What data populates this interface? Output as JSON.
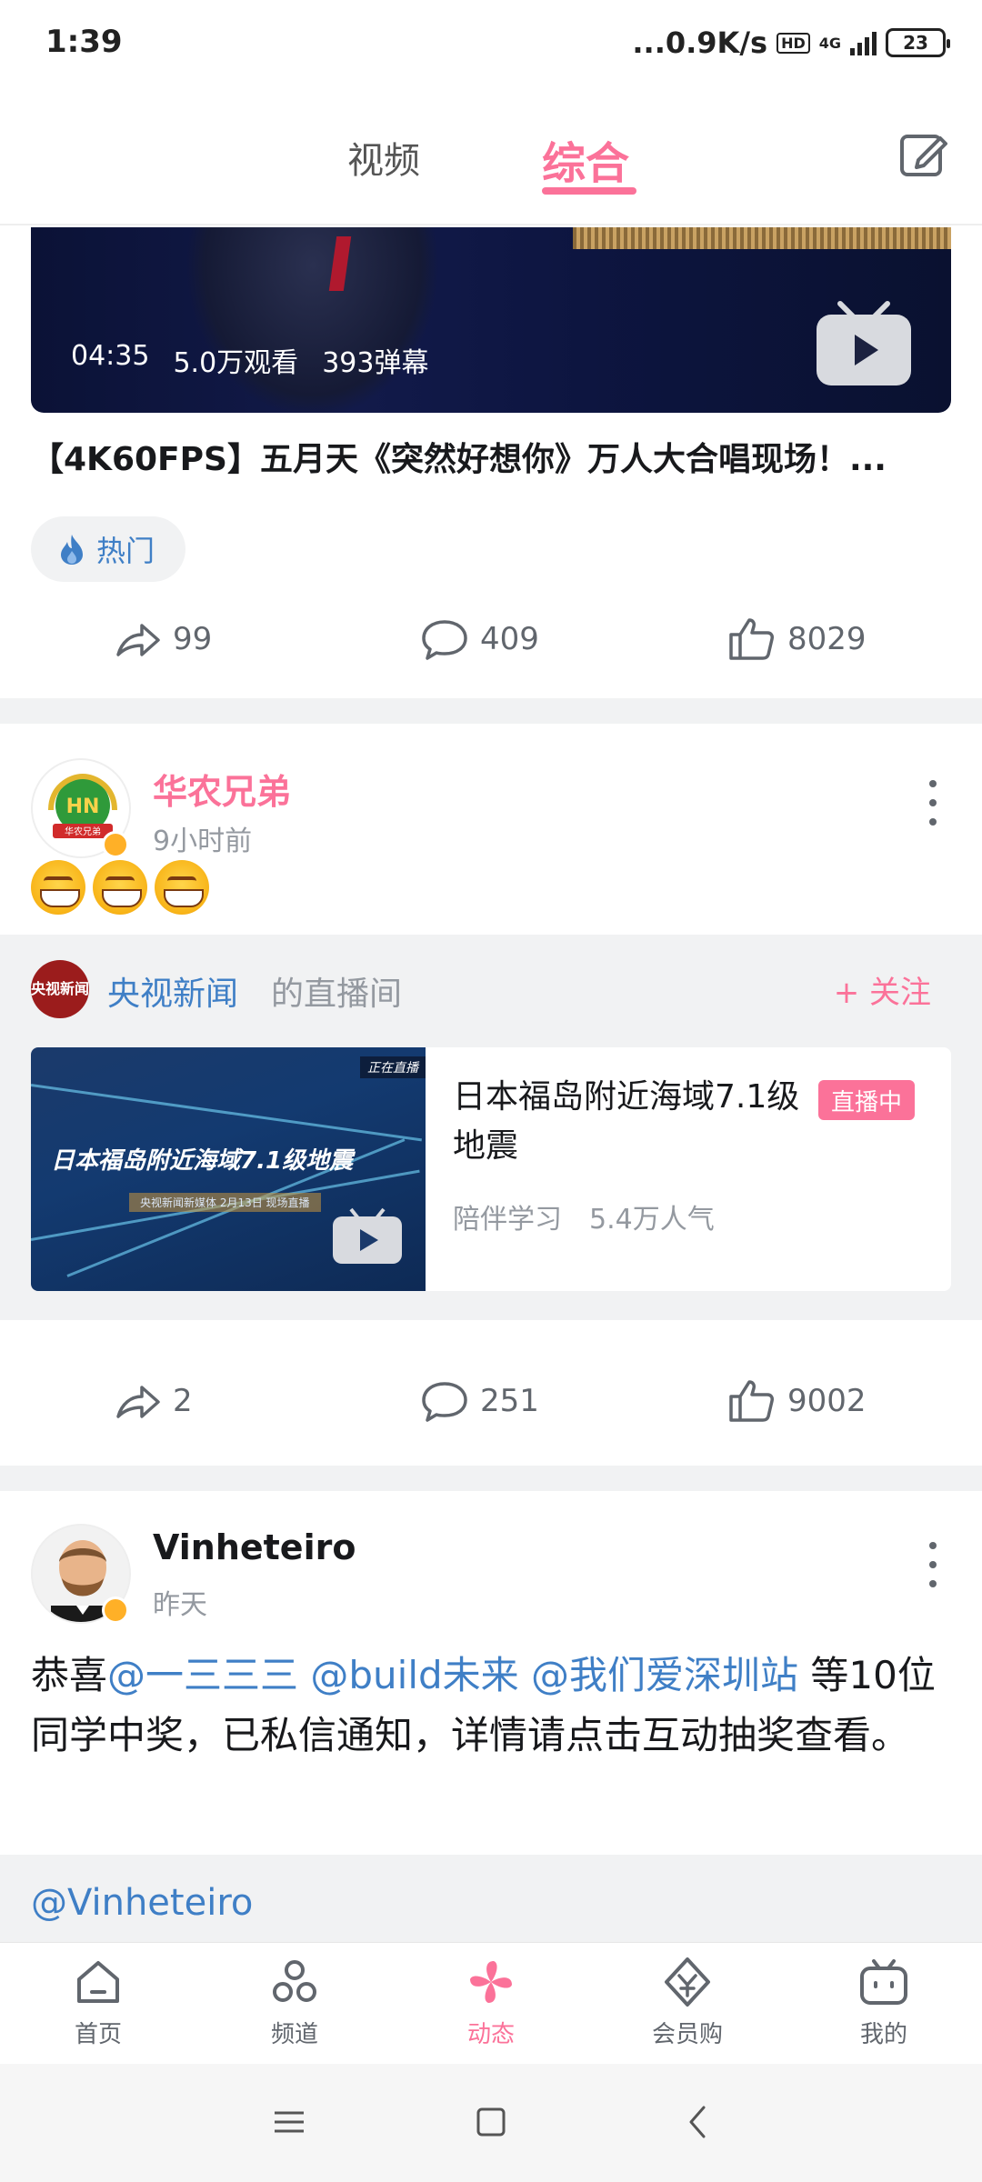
{
  "status_bar": {
    "time": "1:39",
    "network_speed": "...0.9K/s",
    "hd": "HD",
    "network_type": "4G",
    "battery": "23"
  },
  "top_tabs": {
    "video": "视频",
    "all": "综合",
    "active": "综合"
  },
  "posts": [
    {
      "video": {
        "duration": "04:35",
        "views": "5.0万观看",
        "danmaku": "393弹幕",
        "title": "【4K60FPS】五月天《突然好想你》万人大合唱现场！..."
      },
      "tag": "热门",
      "actions": {
        "share": "99",
        "comment": "409",
        "like": "8029"
      }
    },
    {
      "user": "华农兄弟",
      "time": "9小时前",
      "live": {
        "owner": "央视新闻",
        "suffix": "的直播间",
        "follow": "+ 关注",
        "logo_text": "央视新闻",
        "cover_text": "日本福岛附近海域7.1级地震",
        "cover_sub": "央视新闻新媒体 2月13日 现场直播",
        "cover_tag": "正在直播",
        "title": "日本福岛附近海域7.1级地震",
        "badge": "直播中",
        "category": "陪伴学习",
        "popularity": "5.4万人气"
      },
      "actions": {
        "share": "2",
        "comment": "251",
        "like": "9002"
      }
    },
    {
      "user": "Vinheteiro",
      "time": "昨天",
      "text_prefix": "恭喜",
      "mentions": [
        "@一三三三",
        "@build未来",
        "@我们爱深圳站"
      ],
      "text_suffix": " 等10位同学中奖，已私信通知，详情请点击互动抽奖查看。",
      "repost_user": "@Vinheteiro"
    }
  ],
  "bottom_nav": [
    {
      "label": "首页",
      "icon": "home-icon"
    },
    {
      "label": "频道",
      "icon": "channel-icon"
    },
    {
      "label": "动态",
      "icon": "dynamic-icon",
      "active": true
    },
    {
      "label": "会员购",
      "icon": "shop-icon"
    },
    {
      "label": "我的",
      "icon": "tv-icon"
    }
  ],
  "colors": {
    "accent": "#fb7299",
    "link": "#3f7fc6",
    "muted": "#9499a0",
    "live_bg": "#f1f2f3"
  }
}
